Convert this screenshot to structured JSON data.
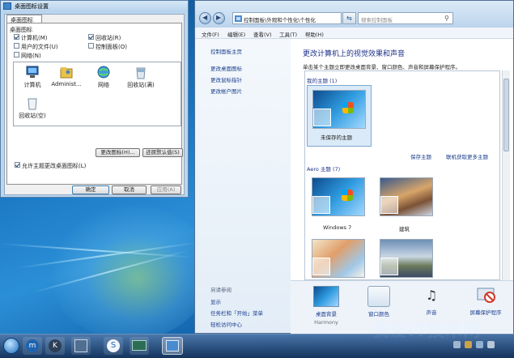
{
  "dialog": {
    "title": "桌面图标设置",
    "tab": "桌面图标",
    "group_label": "桌面图标",
    "checkboxes": [
      {
        "label": "计算机(M)",
        "checked": true
      },
      {
        "label": "回收站(R)",
        "checked": true
      },
      {
        "label": "用户的文件(U)",
        "checked": false
      },
      {
        "label": "控制面板(O)",
        "checked": false
      },
      {
        "label": "网络(N)",
        "checked": false
      }
    ],
    "icons": [
      {
        "label": "计算机"
      },
      {
        "label": "Administ..."
      },
      {
        "label": "网络"
      },
      {
        "label": "回收站(满)"
      },
      {
        "label": "回收站(空)"
      }
    ],
    "change_icon_label": "更改图标(H)...",
    "restore_default_label": "还原默认值(S)",
    "allow_themes_label": "允许主题更改桌面图标(L)",
    "allow_themes_checked": true,
    "ok_label": "确定",
    "cancel_label": "取消",
    "apply_label": "应用(A)"
  },
  "window": {
    "address": "控制面板\\外观和个性化\\个性化",
    "search_placeholder": "搜索控制面板",
    "menu": [
      "文件(F)",
      "编辑(E)",
      "查看(V)",
      "工具(T)",
      "帮助(H)"
    ],
    "sidebar": {
      "home": "控制面板主页",
      "links": [
        "更改桌面图标",
        "更改鼠标指针",
        "更改帐户图片"
      ],
      "see_also_title": "另请参阅",
      "see_also": [
        "显示",
        "任务栏和「开始」菜单",
        "轻松访问中心"
      ]
    },
    "main": {
      "heading": "更改计算机上的视觉效果和声音",
      "description": "单击某个主题立即更改桌面背景、窗口颜色、声音和屏幕保护程序。",
      "my_themes_title": "我的主题 (1)",
      "unsaved_theme": "未保存的主题",
      "save_theme": "保存主题",
      "get_more": "联机获取更多主题",
      "aero_title": "Aero 主题 (7)",
      "aero_themes": [
        "Windows 7",
        "建筑"
      ]
    },
    "bottom": [
      {
        "label": "桌面背景",
        "sub": "Harmony"
      },
      {
        "label": "窗口颜色",
        "sub": ""
      },
      {
        "label": "声音",
        "sub": ""
      },
      {
        "label": "屏幕保护程序",
        "sub": ""
      }
    ]
  },
  "watermark": "我爱IT技术网",
  "colors": {
    "link": "#1a3e8c",
    "heading": "#1e3287",
    "accent": "#3c7fb1"
  }
}
